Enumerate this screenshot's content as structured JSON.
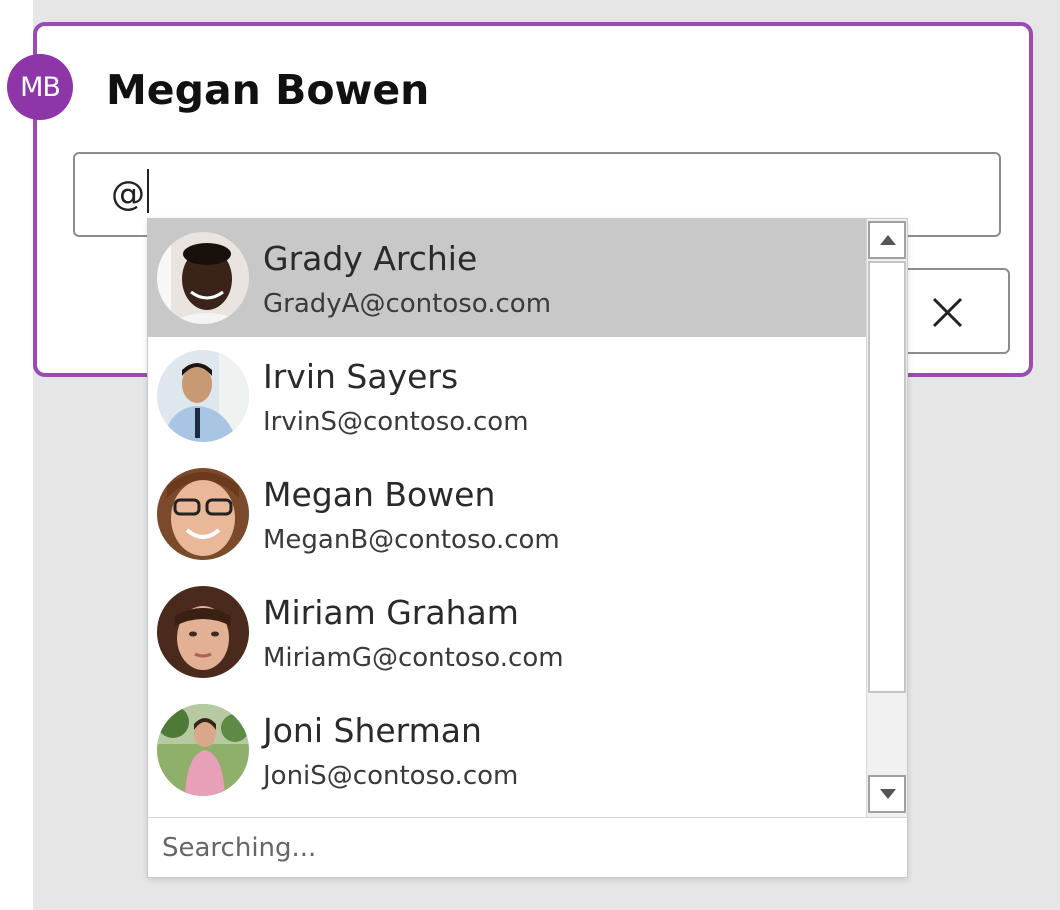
{
  "comment_card": {
    "author_initials": "MB",
    "author_name": "Megan Bowen",
    "input_value": "@",
    "accent_color": "#9a4cb4",
    "close_icon": "close-icon"
  },
  "people_picker": {
    "items": [
      {
        "name": "Grady Archie",
        "email": "GradyA@contoso.com",
        "selected": true,
        "photo_icon": "person-photo-icon"
      },
      {
        "name": "Irvin Sayers",
        "email": "IrvinS@contoso.com",
        "selected": false,
        "photo_icon": "person-photo-icon"
      },
      {
        "name": "Megan Bowen",
        "email": "MeganB@contoso.com",
        "selected": false,
        "photo_icon": "person-photo-icon"
      },
      {
        "name": "Miriam Graham",
        "email": "MiriamG@contoso.com",
        "selected": false,
        "photo_icon": "person-photo-icon"
      },
      {
        "name": "Joni Sherman",
        "email": "JoniS@contoso.com",
        "selected": false,
        "photo_icon": "person-photo-icon"
      }
    ],
    "status_text": "Searching...",
    "scroll_up_icon": "arrow-up-icon",
    "scroll_down_icon": "arrow-down-icon"
  }
}
